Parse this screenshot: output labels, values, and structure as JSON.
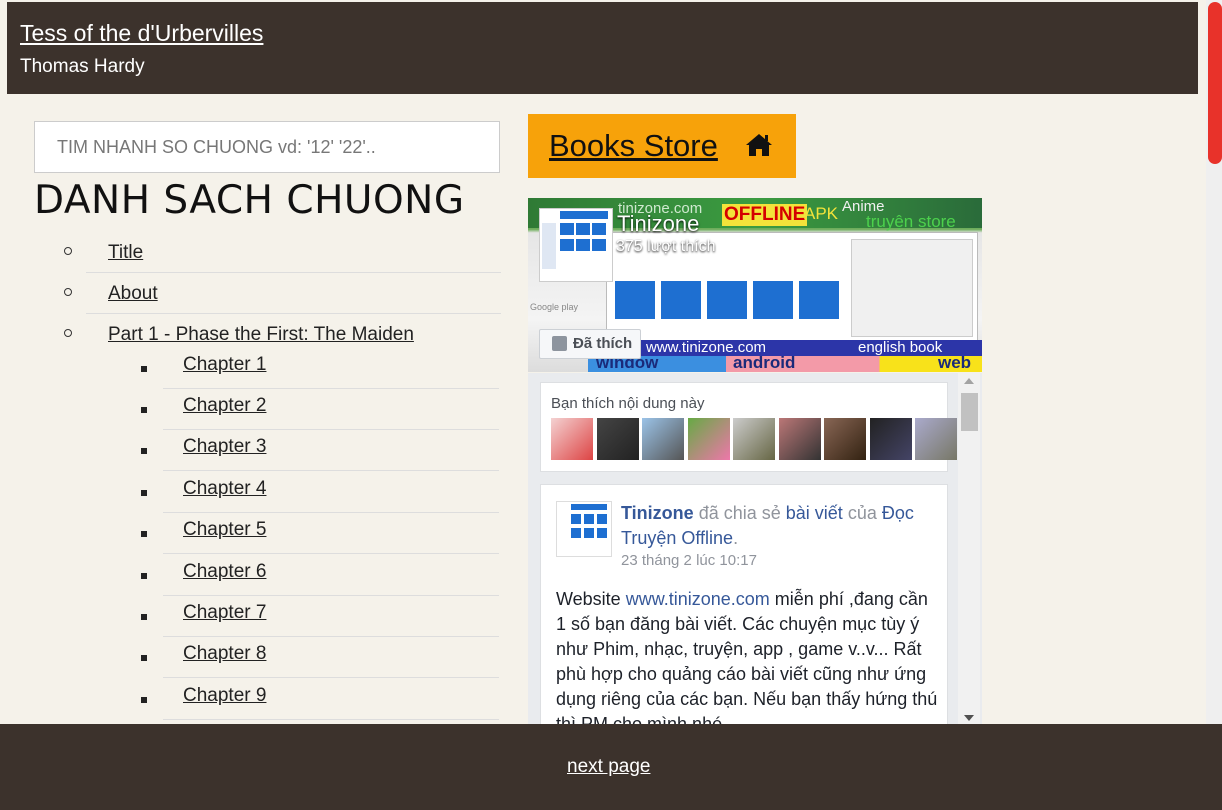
{
  "header": {
    "book_title": "Tess of the d'Urbervilles",
    "author": "Thomas Hardy"
  },
  "search": {
    "placeholder": "TIM NHANH SO CHUONG vd: '12' '22'.."
  },
  "chapter_list": {
    "heading": "DANH SACH CHUONG",
    "top_items": [
      "Title",
      "About",
      "Part 1 - Phase the First: The Maiden"
    ],
    "chapters": [
      "Chapter 1",
      "Chapter 2",
      "Chapter 3",
      "Chapter 4",
      "Chapter 5",
      "Chapter 6",
      "Chapter 7",
      "Chapter 8",
      "Chapter 9"
    ]
  },
  "store_button": {
    "label": "Books Store",
    "icon": "home-icon"
  },
  "facebook": {
    "cover_words": {
      "site": "tinizone.com",
      "offline": "OFFLINE",
      "apk": "APK",
      "anime": "Anime",
      "store": "truyện store",
      "url": "www.tinizone.com",
      "english": "english book",
      "window": "window",
      "android": "android",
      "web": "web",
      "google": "Google play"
    },
    "page_name": "Tinizone",
    "likes": "375 lượt thích",
    "like_button": "Đã thích",
    "friends_title": "Bạn thích nội dung này",
    "post": {
      "author": "Tinizone",
      "shared_text": "đã chia sẻ",
      "post_link": "bài viết",
      "of_text": "của",
      "source": "Đọc Truyện Offline",
      "time": "23 tháng 2 lúc 10:17",
      "body_1": "Website",
      "body_link": "www.tinizone.com",
      "body_2": "miễn phí ,đang cần 1 số bạn đăng bài viết. Các chuyện mục tùy ý như Phim, nhạc, truyện, app , game v..v... Rất phù hợp cho quảng cáo bài viết cũng như ứng dụng riêng của các bạn. Nếu bạn thấy hứng thú thì PM cho mình nhé"
    }
  },
  "footer": {
    "next_label": "next page"
  },
  "colors": {
    "header_bg": "#3c322c",
    "page_bg": "#f5f2ea",
    "store_orange": "#f7a20a",
    "scroll_thumb": "#e8322a",
    "fb_blue": "#365899"
  }
}
